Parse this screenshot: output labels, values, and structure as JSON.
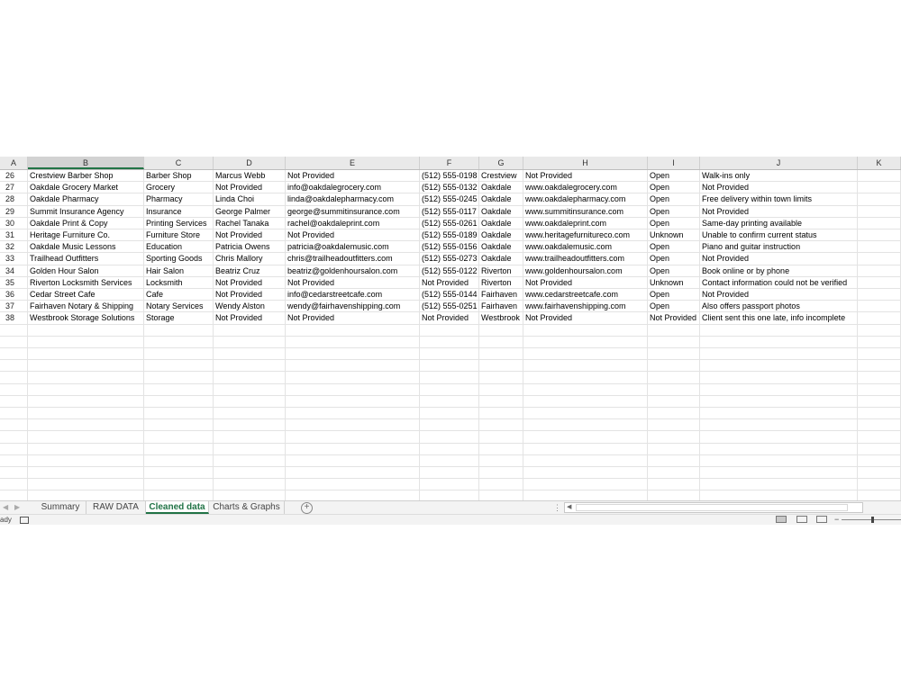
{
  "columns": [
    "A",
    "B",
    "C",
    "D",
    "E",
    "F",
    "G",
    "H",
    "I",
    "J",
    "K"
  ],
  "selected_column": "B",
  "rows": [
    {
      "n": "26",
      "cells": [
        "Crestview Barber Shop",
        "Barber Shop",
        "Marcus Webb",
        "Not Provided",
        "(512) 555-0198",
        "Crestview",
        "Not Provided",
        "Open",
        "Walk-ins only"
      ]
    },
    {
      "n": "27",
      "cells": [
        "Oakdale Grocery Market",
        "Grocery",
        "Not Provided",
        "info@oakdalegrocery.com",
        "(512) 555-0132",
        "Oakdale",
        "www.oakdalegrocery.com",
        "Open",
        "Not Provided"
      ]
    },
    {
      "n": "28",
      "cells": [
        "Oakdale Pharmacy",
        "Pharmacy",
        "Linda Choi",
        "linda@oakdalepharmacy.com",
        "(512) 555-0245",
        "Oakdale",
        "www.oakdalepharmacy.com",
        "Open",
        "Free delivery within town limits"
      ]
    },
    {
      "n": "29",
      "cells": [
        "Summit Insurance Agency",
        "Insurance",
        "George Palmer",
        "george@summitinsurance.com",
        "(512) 555-0117",
        "Oakdale",
        "www.summitinsurance.com",
        "Open",
        "Not Provided"
      ]
    },
    {
      "n": "30",
      "cells": [
        "Oakdale Print & Copy",
        "Printing Services",
        "Rachel Tanaka",
        "rachel@oakdaleprint.com",
        "(512) 555-0261",
        "Oakdale",
        "www.oakdaleprint.com",
        "Open",
        "Same-day printing available"
      ]
    },
    {
      "n": "31",
      "cells": [
        "Heritage Furniture Co.",
        "Furniture Store",
        "Not Provided",
        "Not Provided",
        "(512) 555-0189",
        "Oakdale",
        "www.heritagefurnitureco.com",
        "Unknown",
        "Unable to confirm current status"
      ]
    },
    {
      "n": "32",
      "cells": [
        "Oakdale Music Lessons",
        "Education",
        "Patricia Owens",
        "patricia@oakdalemusic.com",
        "(512) 555-0156",
        "Oakdale",
        "www.oakdalemusic.com",
        "Open",
        "Piano and guitar instruction"
      ]
    },
    {
      "n": "33",
      "cells": [
        "Trailhead Outfitters",
        "Sporting Goods",
        "Chris Mallory",
        "chris@trailheadoutfitters.com",
        "(512) 555-0273",
        "Oakdale",
        "www.trailheadoutfitters.com",
        "Open",
        "Not Provided"
      ]
    },
    {
      "n": "34",
      "cells": [
        "Golden Hour Salon",
        "Hair Salon",
        "Beatriz Cruz",
        "beatriz@goldenhoursalon.com",
        "(512) 555-0122",
        "Riverton",
        "www.goldenhoursalon.com",
        "Open",
        "Book online or by phone"
      ]
    },
    {
      "n": "35",
      "cells": [
        "Riverton Locksmith Services",
        "Locksmith",
        "Not Provided",
        "Not Provided",
        "Not Provided",
        "Riverton",
        "Not Provided",
        "Unknown",
        "Contact information could not be verified"
      ]
    },
    {
      "n": "36",
      "cells": [
        "Cedar Street Cafe",
        "Cafe",
        "Not Provided",
        "info@cedarstreetcafe.com",
        "(512) 555-0144",
        "Fairhaven",
        "www.cedarstreetcafe.com",
        "Open",
        "Not Provided"
      ]
    },
    {
      "n": "37",
      "cells": [
        "Fairhaven Notary & Shipping",
        "Notary Services",
        "Wendy Alston",
        "wendy@fairhavenshipping.com",
        "(512) 555-0251",
        "Fairhaven",
        "www.fairhavenshipping.com",
        "Open",
        "Also offers passport photos"
      ]
    },
    {
      "n": "38",
      "cells": [
        "Westbrook Storage Solutions",
        "Storage",
        "Not Provided",
        "Not Provided",
        "Not Provided",
        "Westbrook",
        "Not Provided",
        "Not Provided",
        "Client sent this one late, info incomplete"
      ]
    }
  ],
  "sheet_tabs": [
    {
      "label": "Summary",
      "active": false
    },
    {
      "label": "RAW DATA",
      "active": false
    },
    {
      "label": "Cleaned data",
      "active": true
    },
    {
      "label": "Charts & Graphs",
      "active": false
    }
  ],
  "add_sheet_label": "+",
  "status": {
    "text": "ady"
  },
  "colors": {
    "accent": "#217346",
    "header_bg": "#e9e9e9",
    "grid_line": "#e3e3e3"
  },
  "icons": [
    "tab-prev-icon",
    "tab-next-icon",
    "add-sheet-icon",
    "macro-record-icon",
    "normal-view-icon",
    "page-layout-view-icon",
    "page-break-view-icon"
  ]
}
